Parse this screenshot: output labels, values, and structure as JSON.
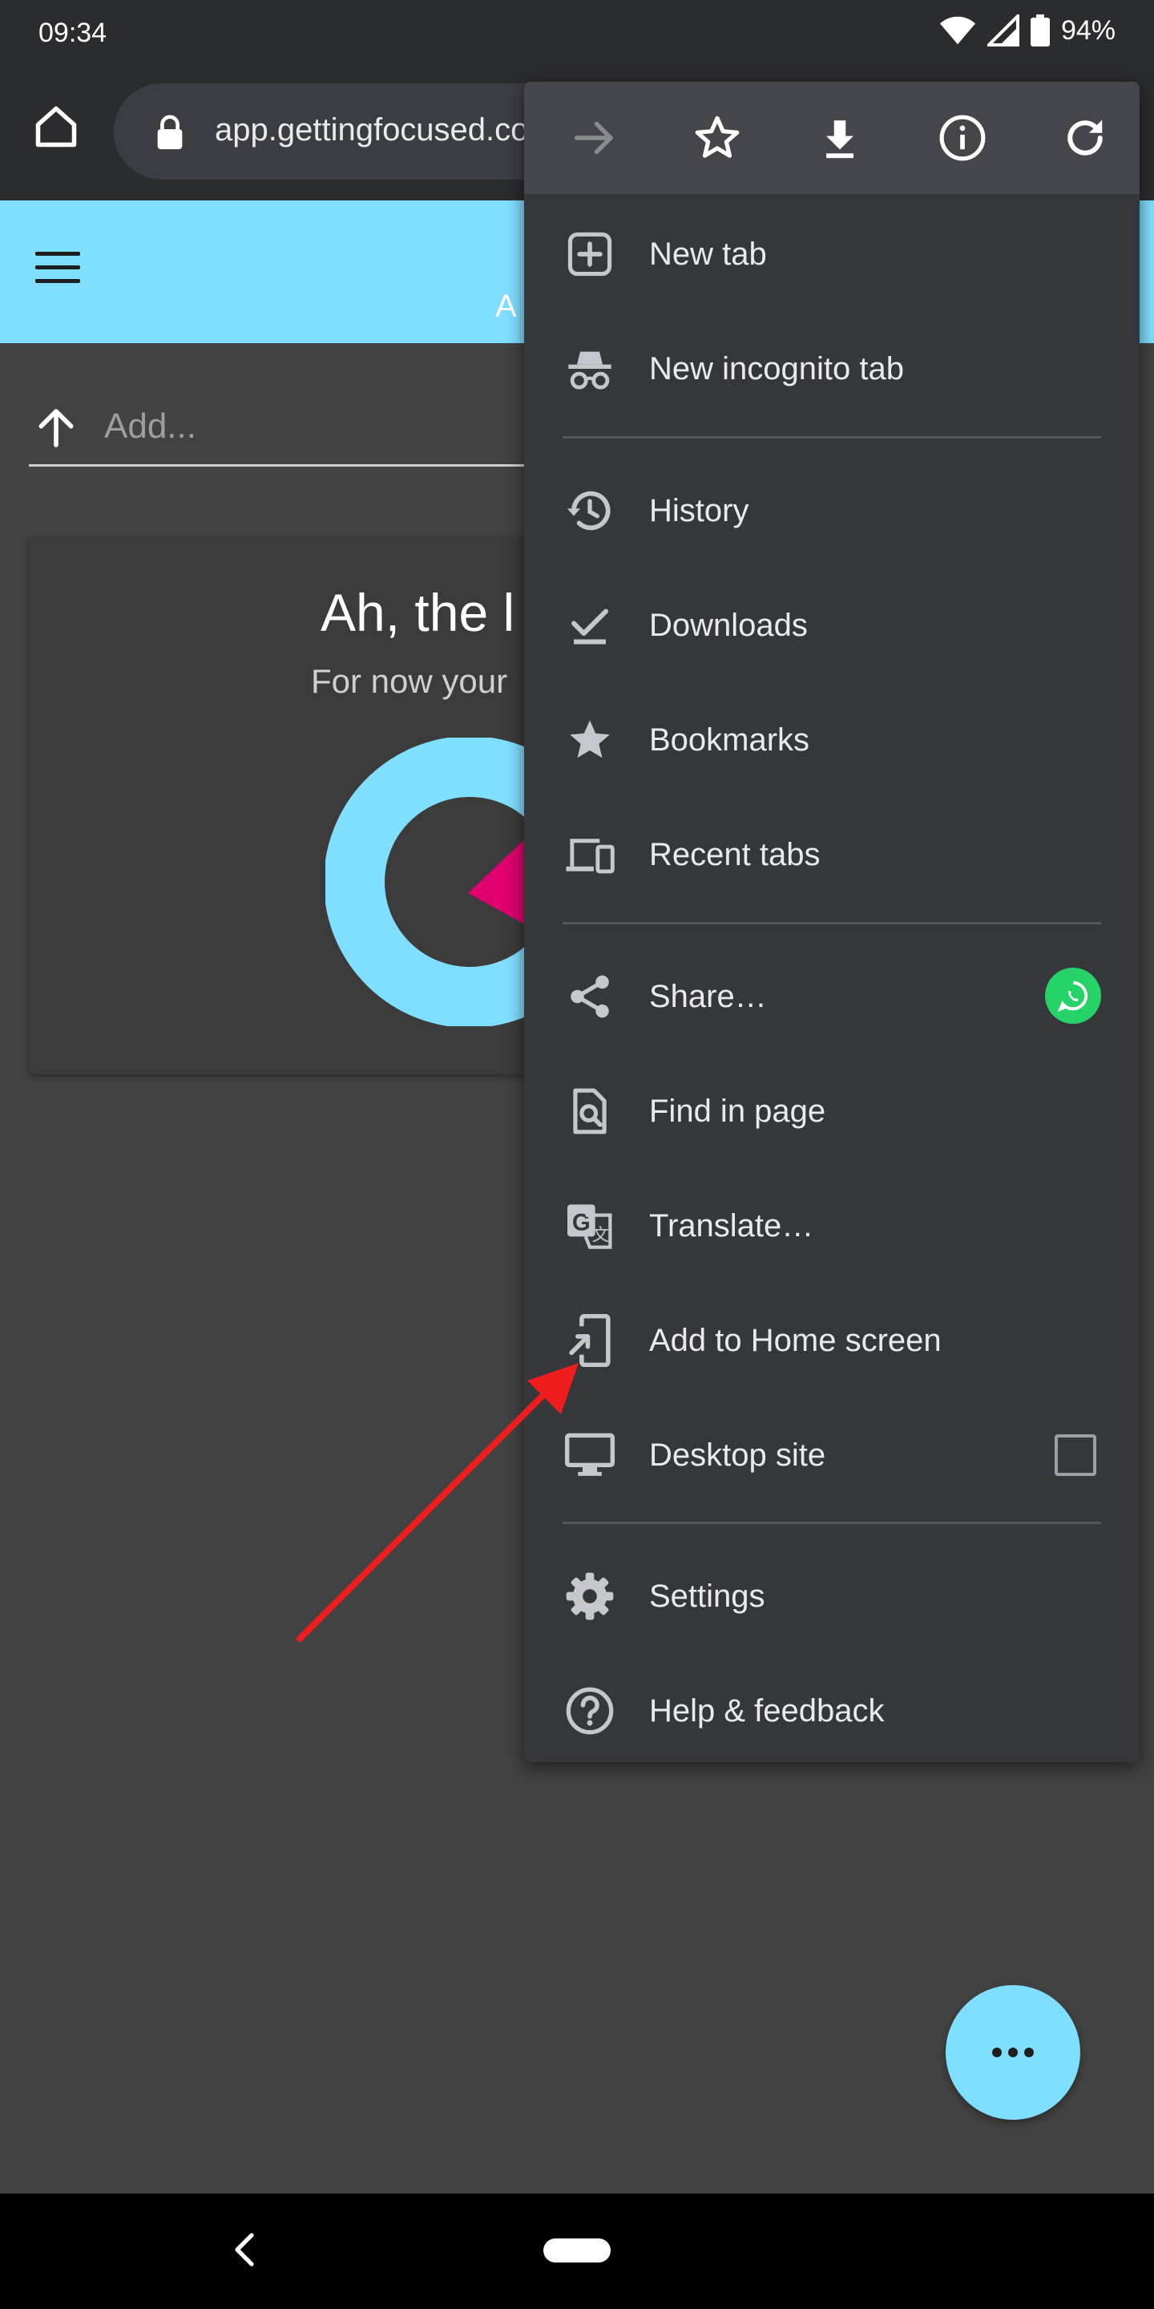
{
  "status_bar": {
    "time": "09:34",
    "battery": "94%",
    "icons": [
      "wifi-icon",
      "signal-icon",
      "battery-icon"
    ]
  },
  "browser": {
    "url": "app.gettingfocused.co",
    "toolbar_icons": [
      "home-icon",
      "lock-icon"
    ]
  },
  "page": {
    "app_bar_color": "#80deff",
    "app_bar_tab": "A",
    "add_placeholder": "Add...",
    "card_title": "Ah, the l",
    "card_subtitle": "For now your"
  },
  "menu": {
    "action_icons": [
      "forward-icon",
      "star-icon",
      "download-icon",
      "info-icon",
      "reload-icon"
    ],
    "items": [
      {
        "label": "New tab",
        "icon": "new-tab-icon"
      },
      {
        "label": "New incognito tab",
        "icon": "incognito-icon"
      },
      {
        "label": "History",
        "icon": "history-icon"
      },
      {
        "label": "Downloads",
        "icon": "downloads-icon"
      },
      {
        "label": "Bookmarks",
        "icon": "bookmarks-icon"
      },
      {
        "label": "Recent tabs",
        "icon": "recent-tabs-icon"
      },
      {
        "label": "Share…",
        "icon": "share-icon",
        "badge": "whatsapp-icon"
      },
      {
        "label": "Find in page",
        "icon": "find-in-page-icon"
      },
      {
        "label": "Translate…",
        "icon": "translate-icon"
      },
      {
        "label": "Add to Home screen",
        "icon": "add-to-home-screen-icon"
      },
      {
        "label": "Desktop site",
        "icon": "desktop-icon",
        "checked": false
      },
      {
        "label": "Settings",
        "icon": "settings-icon"
      },
      {
        "label": "Help & feedback",
        "icon": "help-icon"
      }
    ]
  },
  "annotation": {
    "color": "#ee1c1c",
    "points_to": "Add to Home screen"
  },
  "fab": {
    "icon": "more-horiz-icon",
    "color": "#80deff"
  },
  "nav_bar": {
    "icons": [
      "back-icon",
      "home-pill"
    ]
  }
}
